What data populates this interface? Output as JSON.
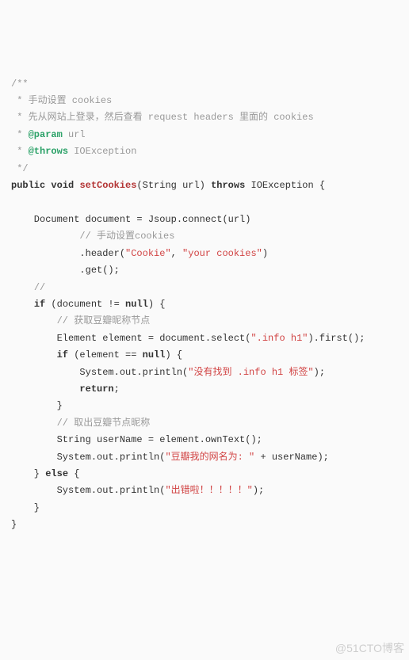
{
  "doc": {
    "open": "/**",
    "l1_pre": " * ",
    "l1_txt": "手动设置 cookies",
    "l2_pre": " * ",
    "l2_txt": "先从网站上登录，然后查看 request headers 里面的 cookies",
    "l3_pre": " * ",
    "l3_at": "@param",
    "l3_rest": " url",
    "l4_pre": " * ",
    "l4_at": "@throws",
    "l4_rest": " IOException",
    "close": " */"
  },
  "sig": {
    "kw_public": "public",
    "kw_void": "void",
    "method": "setCookies",
    "params": "(String url) ",
    "kw_throws": "throws",
    "rest": " IOException {"
  },
  "body": {
    "b1": "    Document document = Jsoup.connect(url)",
    "b2_pre": "            ",
    "b2_comment": "// 手动设置cookies",
    "b3a": "            .header(",
    "b3s1": "\"Cookie\"",
    "b3b": ", ",
    "b3s2": "\"your cookies\"",
    "b3c": ")",
    "b4": "            .get();",
    "c1_pre": "    ",
    "c1": "//",
    "if1a": "    ",
    "if1_kw": "if",
    "if1b": " (document != ",
    "if1_null": "null",
    "if1c": ") {",
    "c2_pre": "        ",
    "c2": "// 获取豆瓣昵称节点",
    "sel_a": "        Element element = document.select(",
    "sel_s": "\".info h1\"",
    "sel_b": ").first();",
    "if2a": "        ",
    "if2_kw": "if",
    "if2b": " (element == ",
    "if2_null": "null",
    "if2c": ") {",
    "p1a": "            System.out.println(",
    "p1s": "\"没有找到 .info h1 标签\"",
    "p1b": ");",
    "ret_pre": "            ",
    "ret_kw": "return",
    "ret_post": ";",
    "close_if2": "        }",
    "c3_pre": "        ",
    "c3": "// 取出豆瓣节点昵称",
    "own": "        String userName = element.ownText();",
    "p2a": "        System.out.println(",
    "p2s": "\"豆瓣我的网名为: \"",
    "p2b": " + userName);",
    "else_a": "    } ",
    "else_kw": "else",
    "else_b": " {",
    "p3a": "        System.out.println(",
    "p3s": "\"出错啦！！！！！\"",
    "p3b": ");",
    "close_else": "    }",
    "close_method": "}"
  },
  "watermark": "@51CTO博客"
}
